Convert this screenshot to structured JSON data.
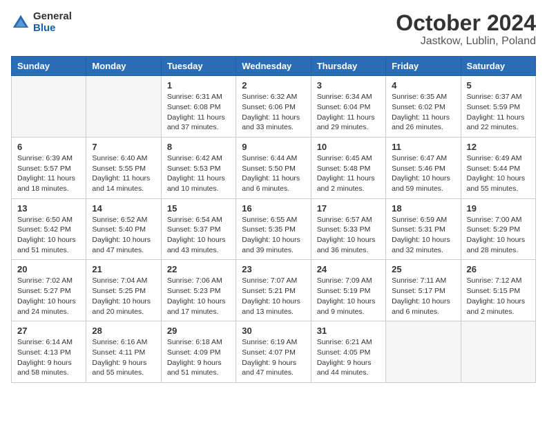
{
  "header": {
    "logo_general": "General",
    "logo_blue": "Blue",
    "month": "October 2024",
    "location": "Jastkow, Lublin, Poland"
  },
  "days_of_week": [
    "Sunday",
    "Monday",
    "Tuesday",
    "Wednesday",
    "Thursday",
    "Friday",
    "Saturday"
  ],
  "weeks": [
    [
      {
        "day": "",
        "info": ""
      },
      {
        "day": "",
        "info": ""
      },
      {
        "day": "1",
        "info": "Sunrise: 6:31 AM\nSunset: 6:08 PM\nDaylight: 11 hours and 37 minutes."
      },
      {
        "day": "2",
        "info": "Sunrise: 6:32 AM\nSunset: 6:06 PM\nDaylight: 11 hours and 33 minutes."
      },
      {
        "day": "3",
        "info": "Sunrise: 6:34 AM\nSunset: 6:04 PM\nDaylight: 11 hours and 29 minutes."
      },
      {
        "day": "4",
        "info": "Sunrise: 6:35 AM\nSunset: 6:02 PM\nDaylight: 11 hours and 26 minutes."
      },
      {
        "day": "5",
        "info": "Sunrise: 6:37 AM\nSunset: 5:59 PM\nDaylight: 11 hours and 22 minutes."
      }
    ],
    [
      {
        "day": "6",
        "info": "Sunrise: 6:39 AM\nSunset: 5:57 PM\nDaylight: 11 hours and 18 minutes."
      },
      {
        "day": "7",
        "info": "Sunrise: 6:40 AM\nSunset: 5:55 PM\nDaylight: 11 hours and 14 minutes."
      },
      {
        "day": "8",
        "info": "Sunrise: 6:42 AM\nSunset: 5:53 PM\nDaylight: 11 hours and 10 minutes."
      },
      {
        "day": "9",
        "info": "Sunrise: 6:44 AM\nSunset: 5:50 PM\nDaylight: 11 hours and 6 minutes."
      },
      {
        "day": "10",
        "info": "Sunrise: 6:45 AM\nSunset: 5:48 PM\nDaylight: 11 hours and 2 minutes."
      },
      {
        "day": "11",
        "info": "Sunrise: 6:47 AM\nSunset: 5:46 PM\nDaylight: 10 hours and 59 minutes."
      },
      {
        "day": "12",
        "info": "Sunrise: 6:49 AM\nSunset: 5:44 PM\nDaylight: 10 hours and 55 minutes."
      }
    ],
    [
      {
        "day": "13",
        "info": "Sunrise: 6:50 AM\nSunset: 5:42 PM\nDaylight: 10 hours and 51 minutes."
      },
      {
        "day": "14",
        "info": "Sunrise: 6:52 AM\nSunset: 5:40 PM\nDaylight: 10 hours and 47 minutes."
      },
      {
        "day": "15",
        "info": "Sunrise: 6:54 AM\nSunset: 5:37 PM\nDaylight: 10 hours and 43 minutes."
      },
      {
        "day": "16",
        "info": "Sunrise: 6:55 AM\nSunset: 5:35 PM\nDaylight: 10 hours and 39 minutes."
      },
      {
        "day": "17",
        "info": "Sunrise: 6:57 AM\nSunset: 5:33 PM\nDaylight: 10 hours and 36 minutes."
      },
      {
        "day": "18",
        "info": "Sunrise: 6:59 AM\nSunset: 5:31 PM\nDaylight: 10 hours and 32 minutes."
      },
      {
        "day": "19",
        "info": "Sunrise: 7:00 AM\nSunset: 5:29 PM\nDaylight: 10 hours and 28 minutes."
      }
    ],
    [
      {
        "day": "20",
        "info": "Sunrise: 7:02 AM\nSunset: 5:27 PM\nDaylight: 10 hours and 24 minutes."
      },
      {
        "day": "21",
        "info": "Sunrise: 7:04 AM\nSunset: 5:25 PM\nDaylight: 10 hours and 20 minutes."
      },
      {
        "day": "22",
        "info": "Sunrise: 7:06 AM\nSunset: 5:23 PM\nDaylight: 10 hours and 17 minutes."
      },
      {
        "day": "23",
        "info": "Sunrise: 7:07 AM\nSunset: 5:21 PM\nDaylight: 10 hours and 13 minutes."
      },
      {
        "day": "24",
        "info": "Sunrise: 7:09 AM\nSunset: 5:19 PM\nDaylight: 10 hours and 9 minutes."
      },
      {
        "day": "25",
        "info": "Sunrise: 7:11 AM\nSunset: 5:17 PM\nDaylight: 10 hours and 6 minutes."
      },
      {
        "day": "26",
        "info": "Sunrise: 7:12 AM\nSunset: 5:15 PM\nDaylight: 10 hours and 2 minutes."
      }
    ],
    [
      {
        "day": "27",
        "info": "Sunrise: 6:14 AM\nSunset: 4:13 PM\nDaylight: 9 hours and 58 minutes."
      },
      {
        "day": "28",
        "info": "Sunrise: 6:16 AM\nSunset: 4:11 PM\nDaylight: 9 hours and 55 minutes."
      },
      {
        "day": "29",
        "info": "Sunrise: 6:18 AM\nSunset: 4:09 PM\nDaylight: 9 hours and 51 minutes."
      },
      {
        "day": "30",
        "info": "Sunrise: 6:19 AM\nSunset: 4:07 PM\nDaylight: 9 hours and 47 minutes."
      },
      {
        "day": "31",
        "info": "Sunrise: 6:21 AM\nSunset: 4:05 PM\nDaylight: 9 hours and 44 minutes."
      },
      {
        "day": "",
        "info": ""
      },
      {
        "day": "",
        "info": ""
      }
    ]
  ]
}
